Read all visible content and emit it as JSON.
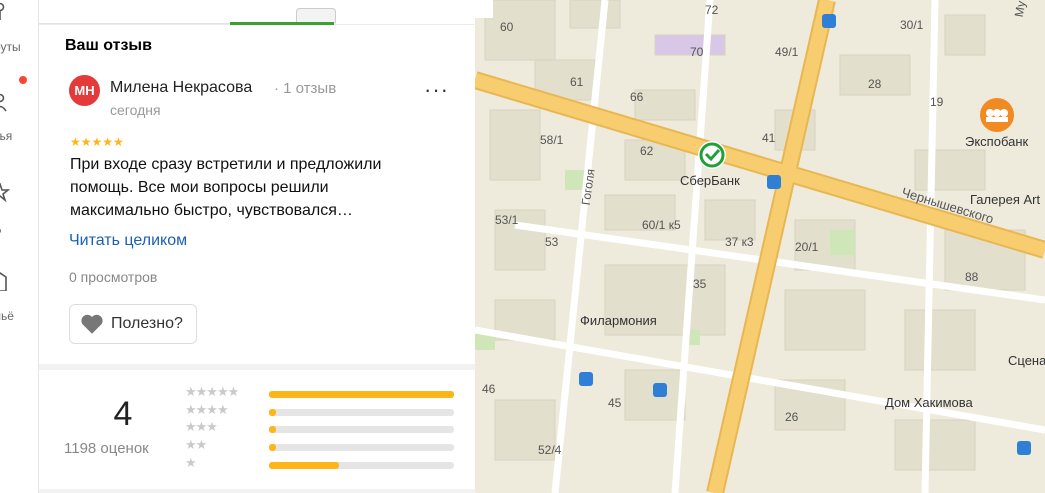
{
  "rail": {
    "items": [
      {
        "label": "руты"
      },
      {
        "label": "зья"
      },
      {
        "label": "д"
      },
      {
        "label": "льё"
      }
    ]
  },
  "review": {
    "section_title": "Ваш отзыв",
    "avatar_initials": "МН",
    "author_name": "Милена Некрасова",
    "author_meta": "· 1 отзыв",
    "date": "сегодня",
    "more": "···",
    "stars": "★★★★★",
    "text": "При входе сразу встретили и предложили помощь. Все мои вопросы решили максимально быстро, чувствовался…",
    "read_more": "Читать целиком",
    "views": "0 просмотров",
    "useful": "Полезно?"
  },
  "summary": {
    "rating": "4",
    "count": "1198 оценок",
    "bars": [
      {
        "stars": "★★★★★",
        "fraction": 1.0
      },
      {
        "stars": "★★★★",
        "fraction": 0.04
      },
      {
        "stars": "★★★",
        "fraction": 0.04
      },
      {
        "stars": "★★",
        "fraction": 0.04
      },
      {
        "stars": "★",
        "fraction": 0.38
      }
    ]
  },
  "map": {
    "places": {
      "sber": "СберБанк",
      "expo": "Экспобанк",
      "gallery": "Галерея Art",
      "phil": "Филармония",
      "hakim": "Дом Хакимова",
      "scene": "Сцена"
    },
    "streets": {
      "gogolya": "Гоголя",
      "chern": "Чернышевского",
      "mu": "Му"
    },
    "house_numbers": [
      "60",
      "72",
      "30/1",
      "70",
      "49/1",
      "61",
      "66",
      "28",
      "19",
      "58/1",
      "62",
      "41",
      "53/1",
      "60/1 к5",
      "37 к3",
      "20/1",
      "53",
      "88",
      "35",
      "46",
      "45",
      "52/4",
      "26"
    ]
  },
  "colors": {
    "accent_tab": "#3ba135",
    "star": "#fdb519",
    "link": "#1a5fb4",
    "road": "#f7c96a"
  }
}
